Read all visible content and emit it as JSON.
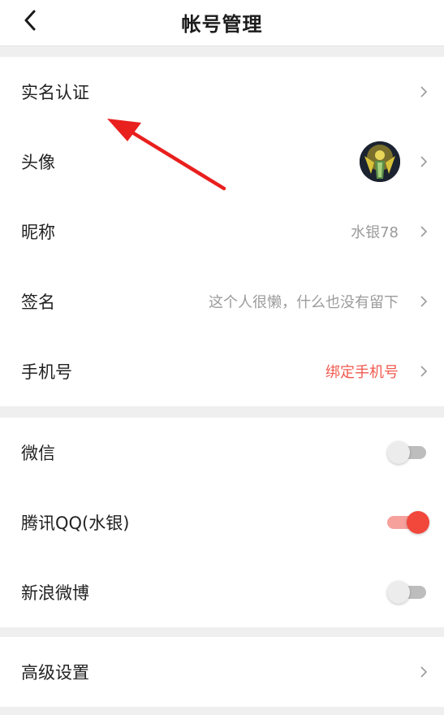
{
  "header": {
    "title": "帐号管理"
  },
  "group1": {
    "realname": {
      "label": "实名认证"
    },
    "avatar": {
      "label": "头像"
    },
    "nickname": {
      "label": "昵称",
      "value": "水银78"
    },
    "signature": {
      "label": "签名",
      "value": "这个人很懒，什么也没有留下"
    },
    "phone": {
      "label": "手机号",
      "value": "绑定手机号"
    }
  },
  "group2": {
    "wechat": {
      "label": "微信",
      "enabled": false
    },
    "qq": {
      "label": "腾讯QQ(水银)",
      "enabled": true
    },
    "weibo": {
      "label": "新浪微博",
      "enabled": false
    }
  },
  "group3": {
    "advanced": {
      "label": "高级设置"
    }
  },
  "colors": {
    "accent_red": "#f2473b",
    "link_red": "#f05a4f",
    "annotation_arrow": "#e8201e"
  },
  "icons": [
    "back-arrow-icon",
    "chevron-right-icon",
    "annotation-arrow-icon"
  ]
}
